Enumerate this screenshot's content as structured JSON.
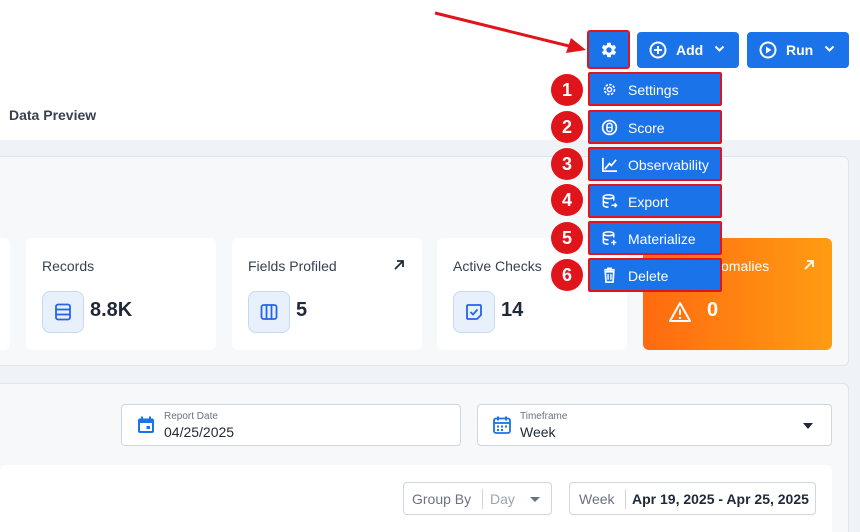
{
  "tabs": {
    "data_preview": "Data Preview"
  },
  "header": {
    "add_label": "Add",
    "run_label": "Run",
    "settings_icon": "gear-icon",
    "accent_color": "#1a73e8",
    "highlight_color": "#e0151b"
  },
  "settings_menu": {
    "items": [
      {
        "number": "1",
        "label": "Settings",
        "icon": "gear-icon"
      },
      {
        "number": "2",
        "label": "Score",
        "icon": "score-icon"
      },
      {
        "number": "3",
        "label": "Observability",
        "icon": "line-chart-icon"
      },
      {
        "number": "4",
        "label": "Export",
        "icon": "database-export-icon"
      },
      {
        "number": "5",
        "label": "Materialize",
        "icon": "database-materialize-icon"
      },
      {
        "number": "6",
        "label": "Delete",
        "icon": "trash-icon"
      }
    ]
  },
  "summary": {
    "records": {
      "label": "Records",
      "value": "8.8K",
      "icon": "table-rows-icon"
    },
    "fields_profiled": {
      "label": "Fields Profiled",
      "value": "5",
      "icon": "columns-icon"
    },
    "active_checks": {
      "label": "Active Checks",
      "value": "14",
      "icon": "check-square-icon"
    },
    "anomalies": {
      "label": "omalies",
      "value": "0",
      "icon": "warning-icon",
      "color": "#ff7a10"
    }
  },
  "filters": {
    "report_date": {
      "label": "Report Date",
      "value": "04/25/2025"
    },
    "timeframe": {
      "label": "Timeframe",
      "value": "Week"
    },
    "group_by": {
      "label": "Group By",
      "value": "Day"
    },
    "week": {
      "label": "Week",
      "range": "Apr 19, 2025 - Apr 25, 2025"
    }
  }
}
